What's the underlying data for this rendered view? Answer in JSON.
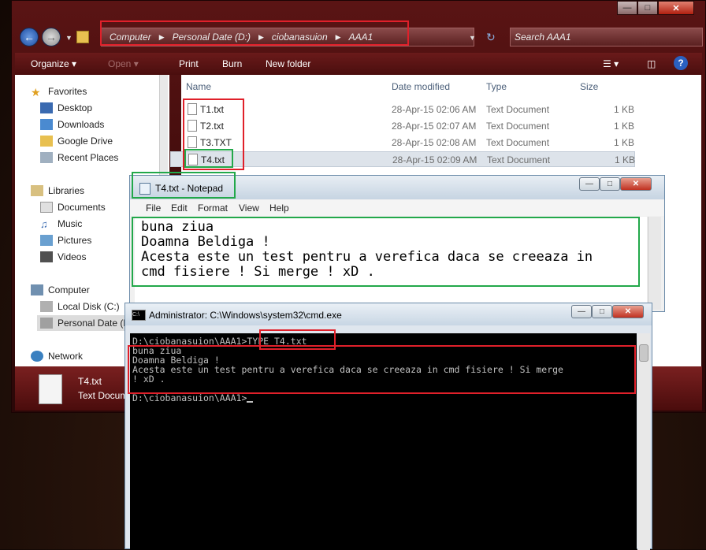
{
  "explorer": {
    "breadcrumb": [
      "Computer",
      "Personal Date (D:)",
      "ciobanasuion",
      "AAA1"
    ],
    "search_placeholder": "Search AAA1",
    "toolbar": {
      "organize": "Organize ▾",
      "open": "Open ▾",
      "print": "Print",
      "burn": "Burn",
      "new_folder": "New folder"
    },
    "nav": {
      "favorites": "Favorites",
      "desktop": "Desktop",
      "downloads": "Downloads",
      "google_drive": "Google Drive",
      "recent_places": "Recent Places",
      "libraries": "Libraries",
      "documents": "Documents",
      "music": "Music",
      "pictures": "Pictures",
      "videos": "Videos",
      "computer": "Computer",
      "local_disk": "Local Disk (C:)",
      "personal_date": "Personal Date (D:)",
      "network": "Network"
    },
    "columns": {
      "name": "Name",
      "date": "Date modified",
      "type": "Type",
      "size": "Size"
    },
    "files": [
      {
        "name": "T1.txt",
        "date": "28-Apr-15 02:06 AM",
        "type": "Text Document",
        "size": "1 KB"
      },
      {
        "name": "T2.txt",
        "date": "28-Apr-15 02:07 AM",
        "type": "Text Document",
        "size": "1 KB"
      },
      {
        "name": "T3.TXT",
        "date": "28-Apr-15 02:08 AM",
        "type": "Text Document",
        "size": "1 KB"
      },
      {
        "name": "T4.txt",
        "date": "28-Apr-15 02:09 AM",
        "type": "Text Document",
        "size": "1 KB"
      }
    ],
    "details": {
      "filename": "T4.txt",
      "filetype": "Text Document"
    }
  },
  "notepad": {
    "title": "T4.txt - Notepad",
    "menu": {
      "file": "File",
      "edit": "Edit",
      "format": "Format",
      "view": "View",
      "help": "Help"
    },
    "lines": [
      "buna ziua",
      "Doamna Beldiga !",
      "Acesta este un test pentru a verefica daca se creeaza in",
      "cmd fisiere ! Si merge ! xD ."
    ]
  },
  "cmd": {
    "title": "Administrator: C:\\Windows\\system32\\cmd.exe",
    "lines": [
      "D:\\ciobanasuion\\AAA1>TYPE T4.txt",
      "buna ziua",
      "Doamna Beldiga !",
      "Acesta este un test pentru a verefica daca se creeaza in cmd fisiere ! Si merge",
      "! xD .",
      "",
      "D:\\ciobanasuion\\AAA1>"
    ]
  }
}
